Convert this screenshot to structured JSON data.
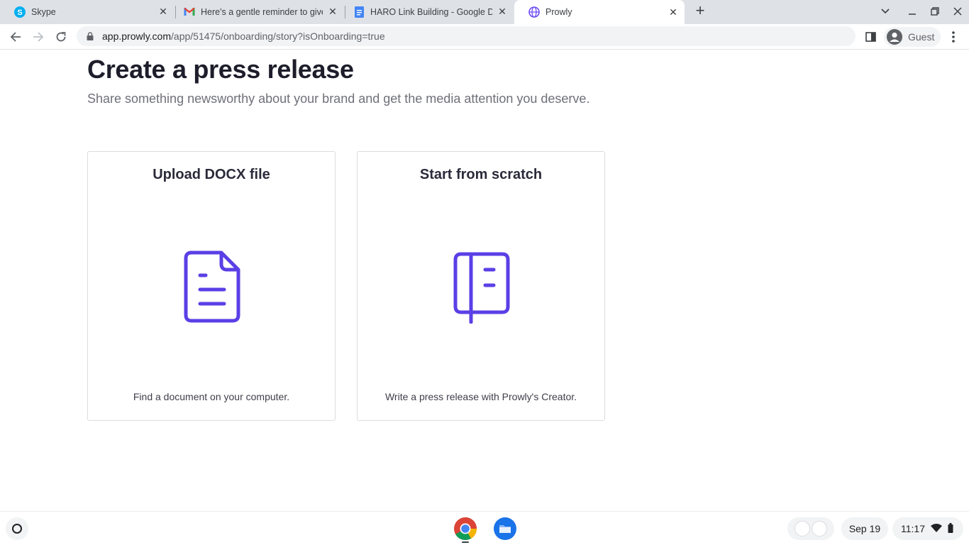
{
  "browser": {
    "tabs": [
      {
        "title": "Skype",
        "icon": "skype-icon",
        "active": false
      },
      {
        "title": "Here's a gentle reminder to give",
        "icon": "gmail-icon",
        "active": false
      },
      {
        "title": "HARO Link Building - Google Doc",
        "icon": "google-docs-icon",
        "active": false
      },
      {
        "title": "Prowly",
        "icon": "prowly-icon",
        "active": true
      }
    ],
    "new_tab_symbol": "+",
    "close_symbol": "✕",
    "url_host": "app.prowly.com",
    "url_path": "/app/51475/onboarding/story?isOnboarding=true",
    "profile_label": "Guest"
  },
  "page": {
    "title": "Create a press release",
    "subtitle": "Share something newsworthy about your brand and get the media attention you deserve.",
    "cards": [
      {
        "title": "Upload DOCX file",
        "icon": "document-icon",
        "description": "Find a document on your computer."
      },
      {
        "title": "Start from scratch",
        "icon": "notebook-icon",
        "description": "Write a press release with Prowly's Creator."
      }
    ],
    "accent_color": "#5b3fe6"
  },
  "shelf": {
    "apps": [
      "chrome-icon",
      "files-icon"
    ],
    "date": "Sep 19",
    "time": "11:17"
  }
}
